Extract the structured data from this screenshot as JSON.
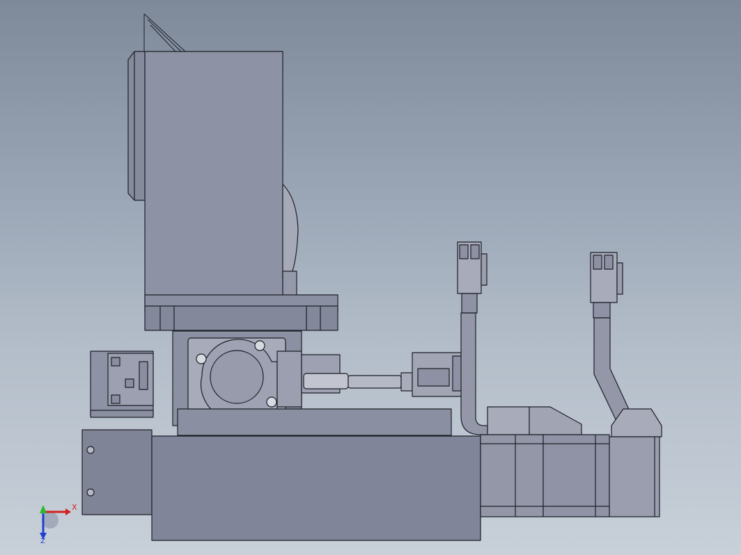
{
  "view": {
    "background_top": "#7e8a9a",
    "background_bottom": "#c8d0d9",
    "part_fill": "#8e93a5",
    "edge_color": "#1d1f27"
  },
  "triad": {
    "x_label": "X",
    "z_label": "Z",
    "x_color": "#d42020",
    "y_color": "#2eb82e",
    "z_color": "#2040d0"
  }
}
